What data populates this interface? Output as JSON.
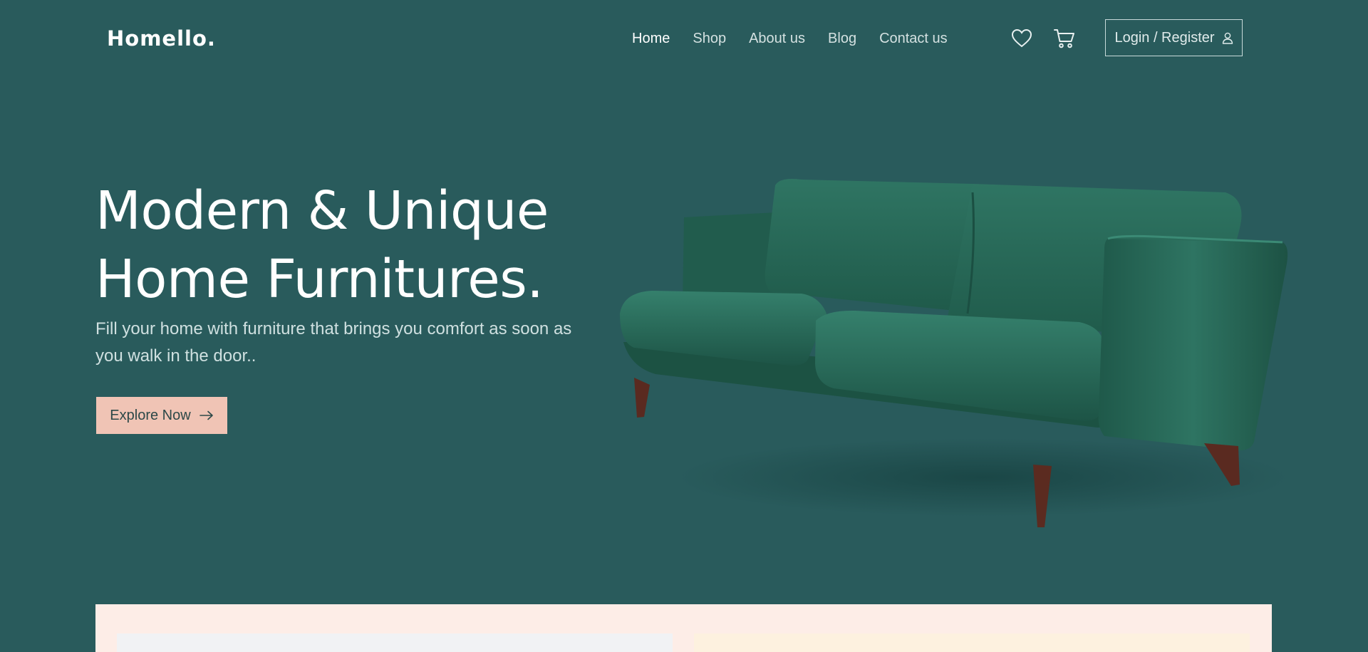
{
  "header": {
    "logo": "Homello.",
    "nav": [
      {
        "label": "Home",
        "active": true
      },
      {
        "label": "Shop",
        "active": false
      },
      {
        "label": "About us",
        "active": false
      },
      {
        "label": "Blog",
        "active": false
      },
      {
        "label": "Contact us",
        "active": false
      }
    ],
    "wishlist_icon": "heart-icon",
    "cart_icon": "cart-icon",
    "login_label": "Login / Register",
    "login_icon": "user-icon"
  },
  "hero": {
    "title_line1": "Modern & Unique",
    "title_line2": "Home Furnitures.",
    "subtitle": "Fill your home with furniture that brings you comfort as soon as you walk in the door..",
    "cta_label": "Explore Now",
    "cta_icon": "arrow-right-icon",
    "image": "green-velvet-sofa"
  },
  "colors": {
    "background": "#295b5c",
    "cta_background": "#f0c4b5",
    "panel_background": "#fdede7",
    "sofa_green": "#2b6a58"
  }
}
